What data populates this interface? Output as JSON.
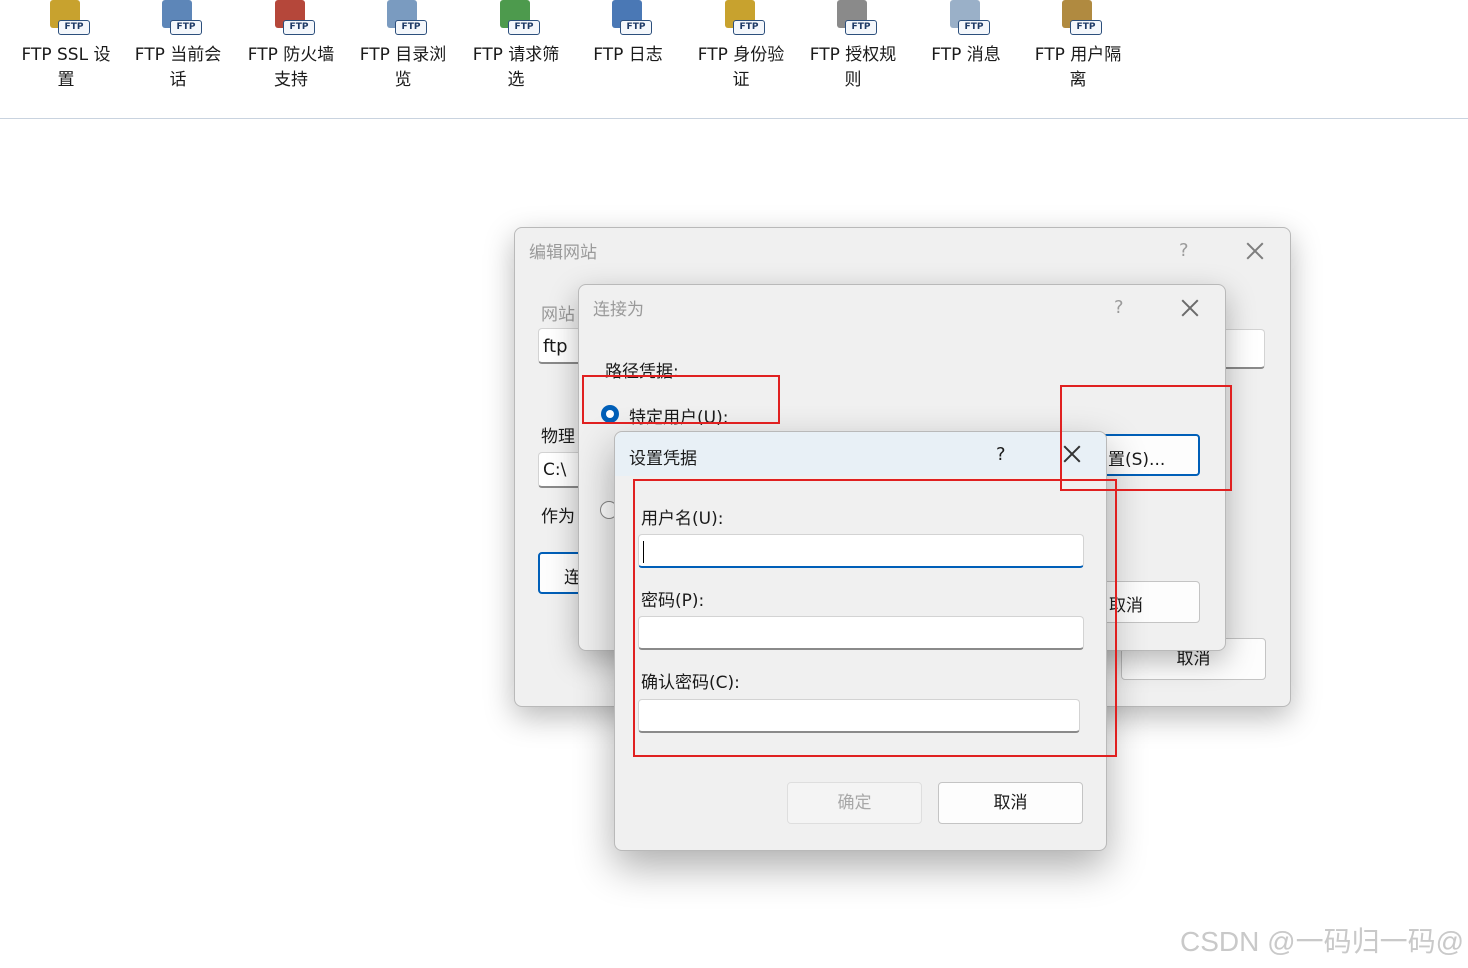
{
  "features": [
    {
      "label": "FTP SSL 设\n置",
      "icon": "ssl-lock-icon",
      "color": "#c8a22e"
    },
    {
      "label": "FTP 当前会\n话",
      "icon": "users-icon",
      "color": "#5d86b8"
    },
    {
      "label": "FTP 防火墙\n支持",
      "icon": "firewall-icon",
      "color": "#b5473a"
    },
    {
      "label": "FTP 目录浏\n览",
      "icon": "directory-browse-icon",
      "color": "#7a9bc0"
    },
    {
      "label": "FTP 请求筛\n选",
      "icon": "request-filter-icon",
      "color": "#4d9a4d"
    },
    {
      "label": "FTP 日志",
      "icon": "log-icon",
      "color": "#4a78b5"
    },
    {
      "label": "FTP 身份验\n证",
      "icon": "authentication-icon",
      "color": "#c8a22e"
    },
    {
      "label": "FTP 授权规\n则",
      "icon": "authorization-key-icon",
      "color": "#8a8a8a"
    },
    {
      "label": "FTP 消息",
      "icon": "message-icon",
      "color": "#9ab0c8"
    },
    {
      "label": "FTP 用户隔\n离",
      "icon": "user-isolation-icon",
      "color": "#b08a40"
    }
  ],
  "ftp_tag": "FTP",
  "edit_site": {
    "title": "编辑网站",
    "help": "?",
    "site_label_partial": "网站",
    "site_value": "ftp",
    "physical_label_partial": "物理",
    "physical_value": "C:\\",
    "as_label_partial": "作为",
    "connect_partial": "连",
    "cancel": "取消"
  },
  "connect_as": {
    "title": "连接为",
    "help": "?",
    "path_credentials": "路径凭据:",
    "specific_user": "特定用户(U):",
    "set_button_partial": "置(S)...",
    "cancel_partial": "取消"
  },
  "set_credentials": {
    "title": "设置凭据",
    "help": "?",
    "username_label": "用户名(U):",
    "username_value": "",
    "password_label": "密码(P):",
    "confirm_label": "确认密码(C):",
    "ok": "确定",
    "cancel": "取消"
  },
  "watermark": "CSDN @一码归一码@",
  "colors": {
    "accent": "#005fb8",
    "highlight": "#e02020"
  }
}
